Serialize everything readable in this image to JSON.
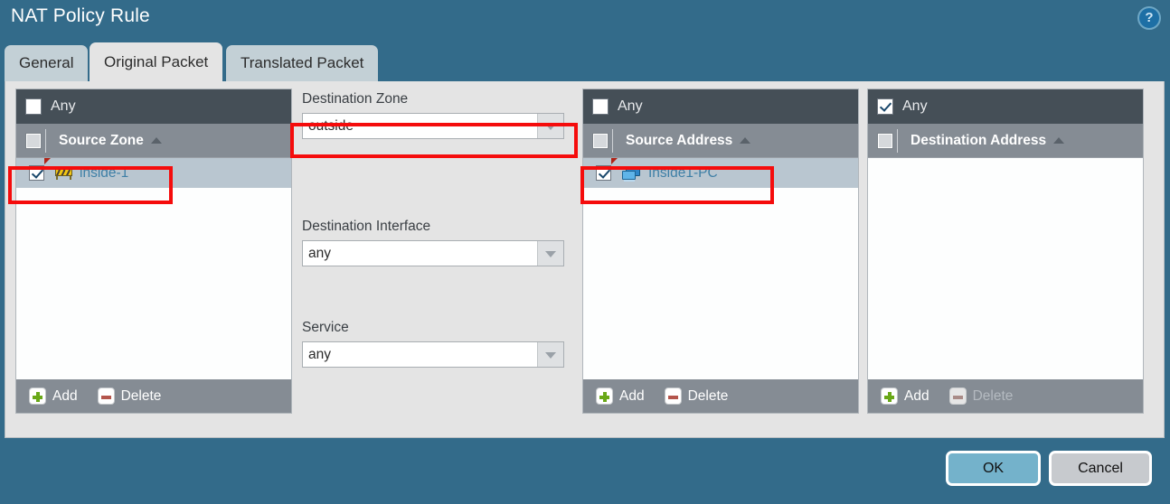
{
  "dialog": {
    "title": "NAT Policy Rule",
    "help_icon": "help-circle-icon",
    "help_glyph": "?"
  },
  "tabs": [
    {
      "label": "General",
      "active": false
    },
    {
      "label": "Original Packet",
      "active": true
    },
    {
      "label": "Translated Packet",
      "active": false
    }
  ],
  "panels": {
    "source_zone": {
      "any_label": "Any",
      "any_checked": false,
      "column_header": "Source Zone",
      "sort_direction": "ascending",
      "rows": [
        {
          "label": "inside-1",
          "checked": true,
          "icon": "zone-barrier-icon",
          "highlighted": true
        }
      ],
      "add_label": "Add",
      "delete_label": "Delete",
      "add_enabled": true,
      "delete_enabled": true
    },
    "source_address": {
      "any_label": "Any",
      "any_checked": false,
      "column_header": "Source Address",
      "sort_direction": "ascending",
      "rows": [
        {
          "label": "Inside1-PC",
          "checked": true,
          "icon": "computer-icon",
          "highlighted": true
        }
      ],
      "add_label": "Add",
      "delete_label": "Delete",
      "add_enabled": true,
      "delete_enabled": true
    },
    "destination_address": {
      "any_label": "Any",
      "any_checked": true,
      "column_header": "Destination Address",
      "sort_direction": "ascending",
      "rows": [],
      "add_label": "Add",
      "delete_label": "Delete",
      "add_enabled": true,
      "delete_enabled": false
    }
  },
  "fields": {
    "destination_zone": {
      "label": "Destination Zone",
      "value": "outside",
      "highlighted": true
    },
    "destination_interface": {
      "label": "Destination Interface",
      "value": "any",
      "highlighted": false
    },
    "service": {
      "label": "Service",
      "value": "any",
      "highlighted": false
    }
  },
  "footer": {
    "ok_label": "OK",
    "cancel_label": "Cancel"
  },
  "colors": {
    "window_background": "#336b8a",
    "content_background": "#e4e4e4",
    "tab_inactive": "#c3d0d6",
    "tab_active": "#e4e4e4",
    "panel_header_dark": "#454f57",
    "panel_header_grey": "#858c94",
    "row_selected": "#b9c6d0",
    "link_text": "#3e7fa6",
    "highlight_red": "#f50c0c",
    "ok_button": "#74b2cb",
    "cancel_button": "#c7cace"
  }
}
